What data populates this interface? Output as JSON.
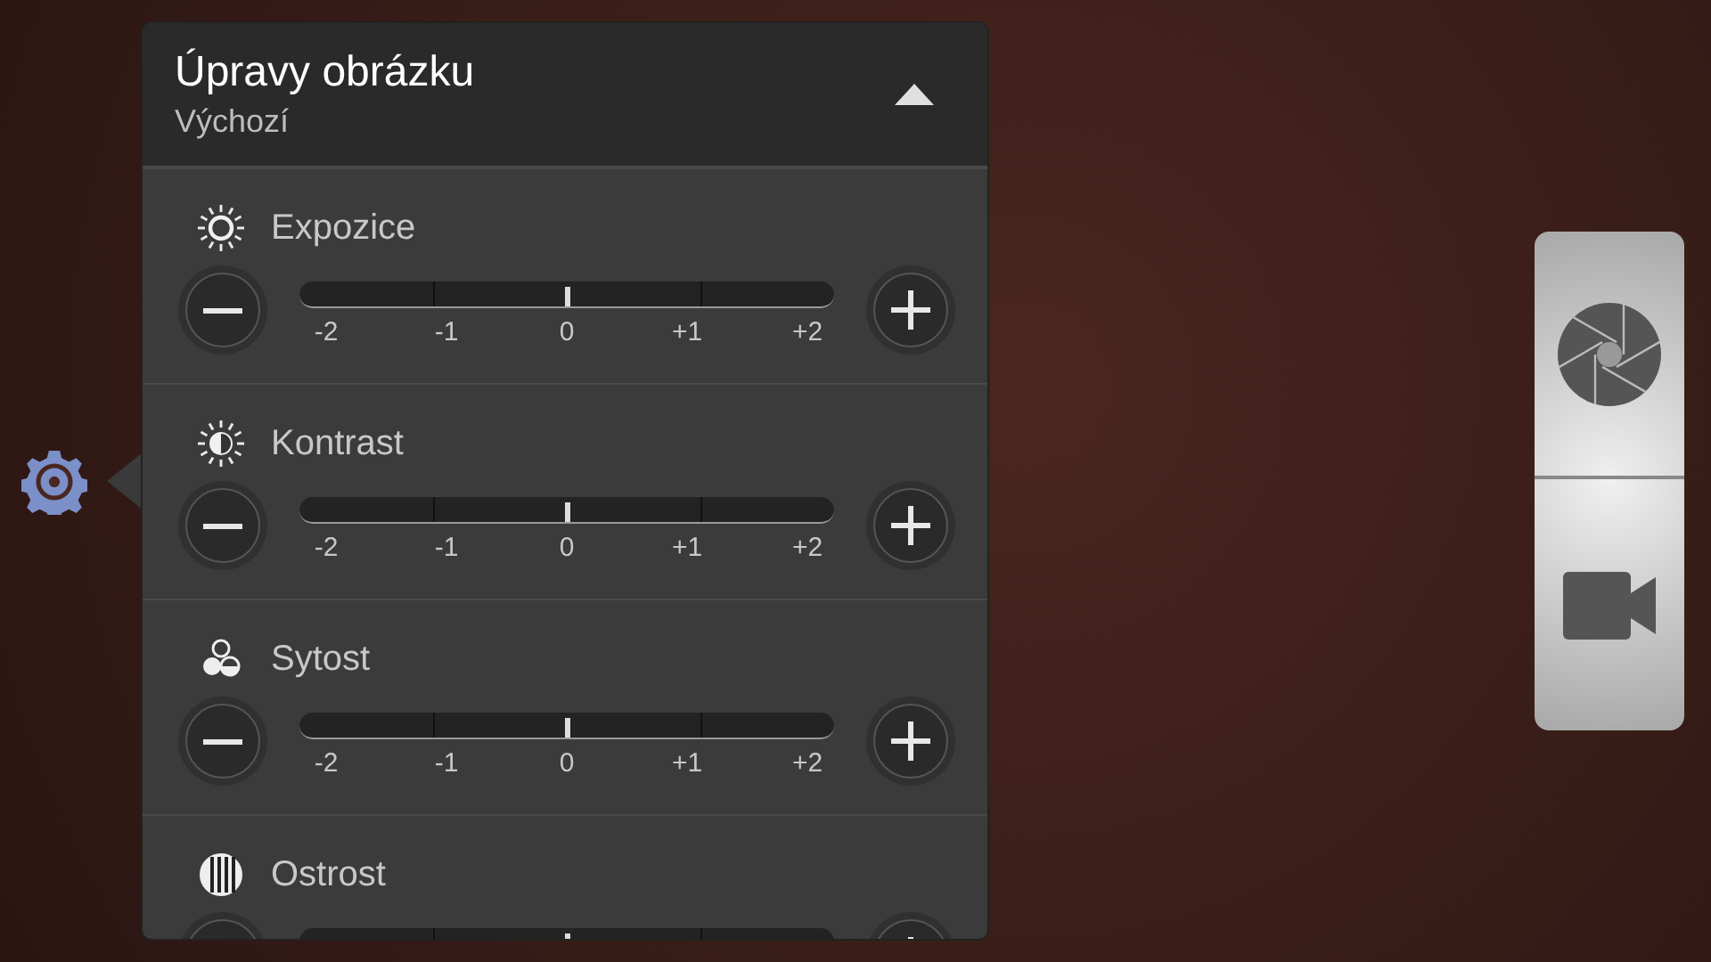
{
  "panel": {
    "title": "Úpravy obrázku",
    "subtitle": "Výchozí",
    "expanded": true
  },
  "settings": [
    {
      "kind": "exposure",
      "label": "Expozice",
      "level": 0.5,
      "ticks": [
        "-2",
        "-1",
        "0",
        "+1",
        "+2"
      ]
    },
    {
      "kind": "contrast",
      "label": "Kontrast",
      "level": 0.5,
      "ticks": [
        "-2",
        "-1",
        "0",
        "+1",
        "+2"
      ]
    },
    {
      "kind": "saturation",
      "label": "Sytost",
      "level": 0.5,
      "ticks": [
        "-2",
        "-1",
        "0",
        "+1",
        "+2"
      ]
    },
    {
      "kind": "sharpness",
      "label": "Ostrost",
      "level": 0.5
    }
  ]
}
